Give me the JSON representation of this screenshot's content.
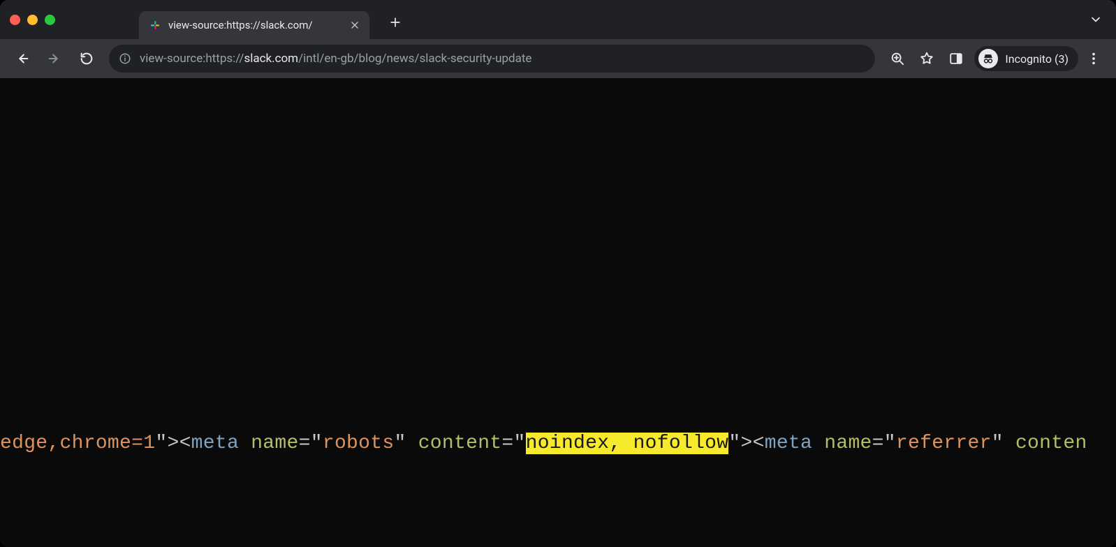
{
  "tab": {
    "title": "view-source:https://slack.com/"
  },
  "address": {
    "prefix": "view-source:https://",
    "host": "slack.com",
    "path": "/intl/en-gb/blog/news/slack-security-update"
  },
  "incognito": {
    "label": "Incognito (3)"
  },
  "source": {
    "seg1_val": "edge,chrome=1",
    "seg_q1": "\"",
    "seg_gt1": ">",
    "seg_lt1": "<",
    "seg_tag1": "meta",
    "seg_sp": " ",
    "seg_attr_name": "name",
    "seg_eq": "=",
    "seg_q2": "\"",
    "seg_val_robots": "robots",
    "seg_q3": "\"",
    "seg_attr_content": "content",
    "seg_q4": "\"",
    "seg_hl": "noindex, nofollow",
    "seg_q5": "\"",
    "seg_gt2": ">",
    "seg_lt2": "<",
    "seg_tag2": "meta",
    "seg_val_referrer": "referrer",
    "seg_tail": "conten"
  }
}
